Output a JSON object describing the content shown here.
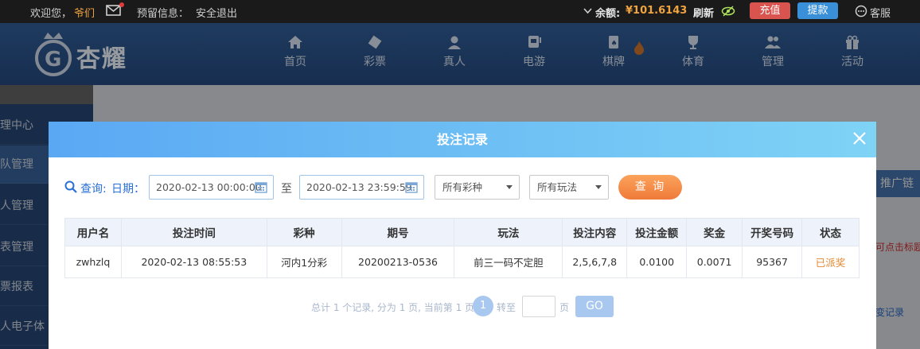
{
  "topbar": {
    "welcome": "欢迎您，",
    "username": "爷们",
    "preview_label": "预留信息：",
    "logout": "安全退出",
    "balance_label": "余额:",
    "balance_value": "¥101.6143",
    "refresh": "刷新",
    "deposit": "充值",
    "withdraw": "提款",
    "service": "客服"
  },
  "logo": {
    "text": "杏耀"
  },
  "nav": [
    {
      "label": "首页",
      "icon": "home-icon"
    },
    {
      "label": "彩票",
      "icon": "lottery-icon"
    },
    {
      "label": "真人",
      "icon": "live-icon"
    },
    {
      "label": "电游",
      "icon": "slots-icon"
    },
    {
      "label": "棋牌",
      "icon": "cards-icon"
    },
    {
      "label": "体育",
      "icon": "sports-icon"
    },
    {
      "label": "管理",
      "icon": "manage-icon"
    },
    {
      "label": "活动",
      "icon": "gift-icon"
    }
  ],
  "sidebar": {
    "items": [
      {
        "label": "理中心"
      },
      {
        "label": "队管理"
      },
      {
        "label": "人管理"
      },
      {
        "label": "表管理"
      },
      {
        "label": "票报表"
      },
      {
        "label": "人电子体"
      }
    ]
  },
  "right": {
    "tab": "推广链",
    "red_text": "可点击标题",
    "blue_text": "变记录"
  },
  "modal": {
    "title": "投注记录",
    "query_label": "查询:",
    "date_label": "日期：",
    "date_start": "2020-02-13 00:00:00",
    "to_label": "至",
    "date_end": "2020-02-13 23:59:59",
    "lottery_select": "所有彩种",
    "play_select": "所有玩法",
    "query_button": "查 询",
    "table": {
      "headers": [
        "用户名",
        "投注时间",
        "彩种",
        "期号",
        "玩法",
        "投注内容",
        "投注金额",
        "奖金",
        "开奖号码",
        "状态"
      ],
      "rows": [
        [
          "zwhzlq",
          "2020-02-13 08:55:53",
          "河内1分彩",
          "20200213-0536",
          "前三一码不定胆",
          "2,5,6,7,8",
          "0.0100",
          "0.0071",
          "95367",
          "已派奖"
        ]
      ]
    },
    "pager": {
      "summary": "总计 1 个记录, 分为 1 页, 当前第 1 页",
      "current_page": "1",
      "goto_label": "转至",
      "page_suffix": "页",
      "go_button": "GO"
    }
  },
  "colors": {
    "topbar_bg": "#1a1a1a",
    "header_bg": "#2f5b93",
    "modal_header": "#5aa8f4",
    "accent_blue": "#2a6fd6",
    "query_orange": "#f07a3a",
    "status_orange": "#e6862c",
    "deposit_red": "#d9534f",
    "withdraw_blue": "#3a8fd9"
  }
}
